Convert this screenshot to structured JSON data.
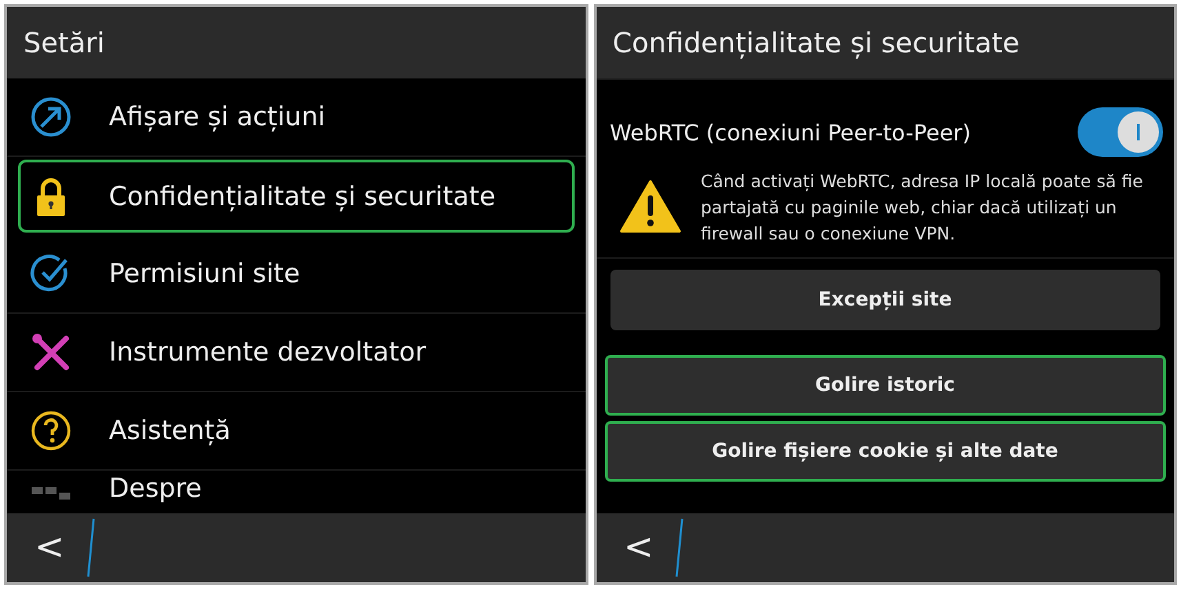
{
  "left_screen": {
    "title": "Setări",
    "items": [
      {
        "label": "Afișare și acțiuni",
        "kind": "display",
        "selected": false
      },
      {
        "label": "Confidențialitate și securitate",
        "kind": "lock",
        "selected": true
      },
      {
        "label": "Permisiuni site",
        "kind": "check",
        "selected": false
      },
      {
        "label": "Instrumente dezvoltator",
        "kind": "tools",
        "selected": false
      },
      {
        "label": "Asistență",
        "kind": "help",
        "selected": false
      },
      {
        "label": "Despre",
        "kind": "about",
        "selected": false
      }
    ],
    "back": "<"
  },
  "right_screen": {
    "title": "Confidențialitate și securitate",
    "webrtc": {
      "label": "WebRTC (conexiuni Peer-to-Peer)",
      "on": true
    },
    "warning": "Când activați WebRTC, adresa IP locală poate să fie partajată cu paginile web, chiar dacă utilizați un firewall sau o conexiune VPN.",
    "buttons": [
      {
        "label": "Excepții site",
        "highlighted": false
      },
      {
        "label": "Golire istoric",
        "highlighted": true
      },
      {
        "label": "Golire fișiere cookie și alte date",
        "highlighted": true
      }
    ],
    "back": "<"
  }
}
